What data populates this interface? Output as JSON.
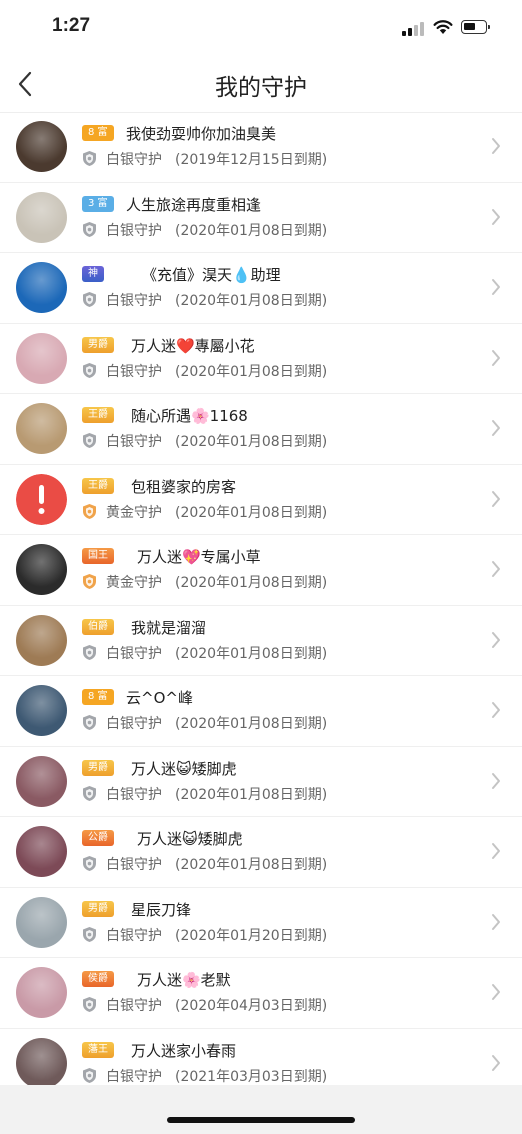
{
  "status": {
    "time": "1:27"
  },
  "header": {
    "title": "我的守护"
  },
  "colors": {
    "wealth_badge_orange": "#f5a623",
    "wealth_badge_blue": "#5aaee6",
    "noble_badge_gold": "#f3b43c",
    "noble_badge_orange": "#ef7d2d",
    "silver_shield": "#a3a6ab",
    "gold_shield": "#f0a34a"
  },
  "rows": [
    {
      "badge": "8 富",
      "badge_kind": "wealth-orange",
      "name": "我使劲耍帅你加油臭美",
      "guard": "白银守护",
      "expire": "(2019年12月15日到期)",
      "shield": "silver",
      "avatar_color": "#4b3a2f"
    },
    {
      "badge": "3 富",
      "badge_kind": "wealth-blue",
      "name": "人生旅途再度重相逢",
      "guard": "白银守护",
      "expire": "(2020年01月08日到期)",
      "shield": "silver",
      "avatar_color": "#c9c3b7"
    },
    {
      "badge": "神",
      "badge_kind": "god",
      "name": "《充值》淏天💧助理",
      "guard": "白银守护",
      "expire": "(2020年01月08日到期)",
      "shield": "silver",
      "avatar_color": "#1c68b8"
    },
    {
      "badge": "男爵",
      "badge_kind": "noble-gold",
      "name": "万人迷❤️專屬小花",
      "guard": "白银守护",
      "expire": "(2020年01月08日到期)",
      "shield": "silver",
      "avatar_color": "#d8a9b3"
    },
    {
      "badge": "王爵",
      "badge_kind": "noble-gold",
      "name": "随心所遇🌸1168",
      "guard": "白银守护",
      "expire": "(2020年01月08日到期)",
      "shield": "silver",
      "avatar_color": "#b89a72"
    },
    {
      "badge": "王爵",
      "badge_kind": "noble-gold",
      "name": "包租婆家的房客",
      "guard": "黄金守护",
      "expire": "(2020年01月08日到期)",
      "shield": "gold",
      "avatar_color": "#ea4c45"
    },
    {
      "badge": "国王",
      "badge_kind": "noble-orange",
      "name": "万人迷💖专属小草",
      "guard": "黄金守护",
      "expire": "(2020年01月08日到期)",
      "shield": "gold",
      "avatar_color": "#2b2b2b"
    },
    {
      "badge": "伯爵",
      "badge_kind": "noble-gold",
      "name": "我就是溜溜",
      "guard": "白银守护",
      "expire": "(2020年01月08日到期)",
      "shield": "silver",
      "avatar_color": "#9e7b55"
    },
    {
      "badge": "8 富",
      "badge_kind": "wealth-orange",
      "name": "云^O^峰",
      "guard": "白银守护",
      "expire": "(2020年01月08日到期)",
      "shield": "silver",
      "avatar_color": "#3e5973"
    },
    {
      "badge": "男爵",
      "badge_kind": "noble-gold",
      "name": "万人迷😺矮脚虎",
      "guard": "白银守护",
      "expire": "(2020年01月08日到期)",
      "shield": "silver",
      "avatar_color": "#8a5a63"
    },
    {
      "badge": "公爵",
      "badge_kind": "noble-orange",
      "name": "万人迷😺矮脚虎",
      "guard": "白银守护",
      "expire": "(2020年01月08日到期)",
      "shield": "silver",
      "avatar_color": "#7d4a57"
    },
    {
      "badge": "男爵",
      "badge_kind": "noble-gold",
      "name": "星辰刀锋",
      "guard": "白银守护",
      "expire": "(2020年01月20日到期)",
      "shield": "silver",
      "avatar_color": "#9aa6ad"
    },
    {
      "badge": "侯爵",
      "badge_kind": "noble-orange",
      "name": "万人迷🌸老默",
      "guard": "白银守护",
      "expire": "(2020年04月03日到期)",
      "shield": "silver",
      "avatar_color": "#c99aa7"
    },
    {
      "badge": "藩王",
      "badge_kind": "noble-gold",
      "name": "万人迷家小春雨",
      "guard": "白银守护",
      "expire": "(2021年03月03日到期)",
      "shield": "silver",
      "avatar_color": "#6f5a5a"
    }
  ]
}
